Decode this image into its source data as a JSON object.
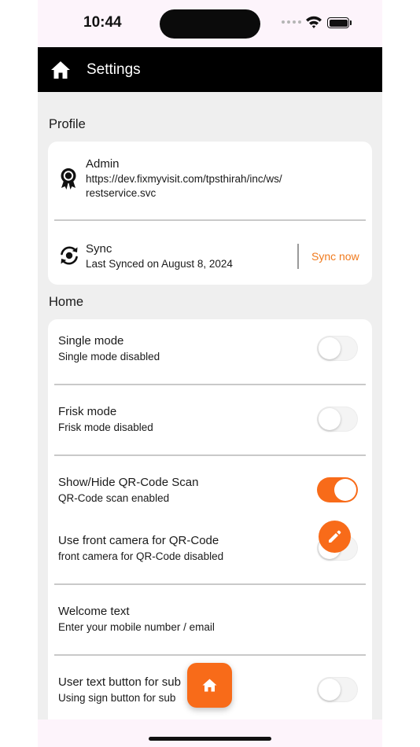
{
  "status_bar": {
    "time": "10:44"
  },
  "app_bar": {
    "title": "Settings",
    "home_icon": "home-icon"
  },
  "profile": {
    "section_title": "Profile",
    "admin": {
      "title": "Admin",
      "url_line1": "https://dev.fixmyvisit.com/tpsthirah/inc/ws/",
      "url_line2": "restservice.svc",
      "icon": "award-ribbon-icon"
    },
    "sync": {
      "title": "Sync",
      "subtitle": "Last Synced on August 8, 2024",
      "action": "Sync now",
      "icon": "sync-icon"
    }
  },
  "home": {
    "section_title": "Home",
    "items": [
      {
        "title": "Single mode",
        "subtitle": "Single mode disabled",
        "enabled": false
      },
      {
        "title": "Frisk mode",
        "subtitle": "Frisk mode disabled",
        "enabled": false
      },
      {
        "title": "Show/Hide QR-Code Scan",
        "subtitle": "QR-Code scan enabled",
        "enabled": true
      },
      {
        "title": "Use front camera for QR-Code",
        "subtitle": "front camera for QR-Code disabled",
        "enabled": false
      },
      {
        "title": "Welcome text",
        "subtitle": "Enter your mobile number / email",
        "action_icon": "pencil-icon"
      },
      {
        "title": "User text button for sub",
        "subtitle": "Using sign button for sub",
        "enabled": false
      }
    ]
  },
  "fab": {
    "icon": "home-icon"
  },
  "colors": {
    "accent": "#f86b19",
    "link": "#f07a1d",
    "app_bar": "#000000",
    "background": "#efefef"
  }
}
